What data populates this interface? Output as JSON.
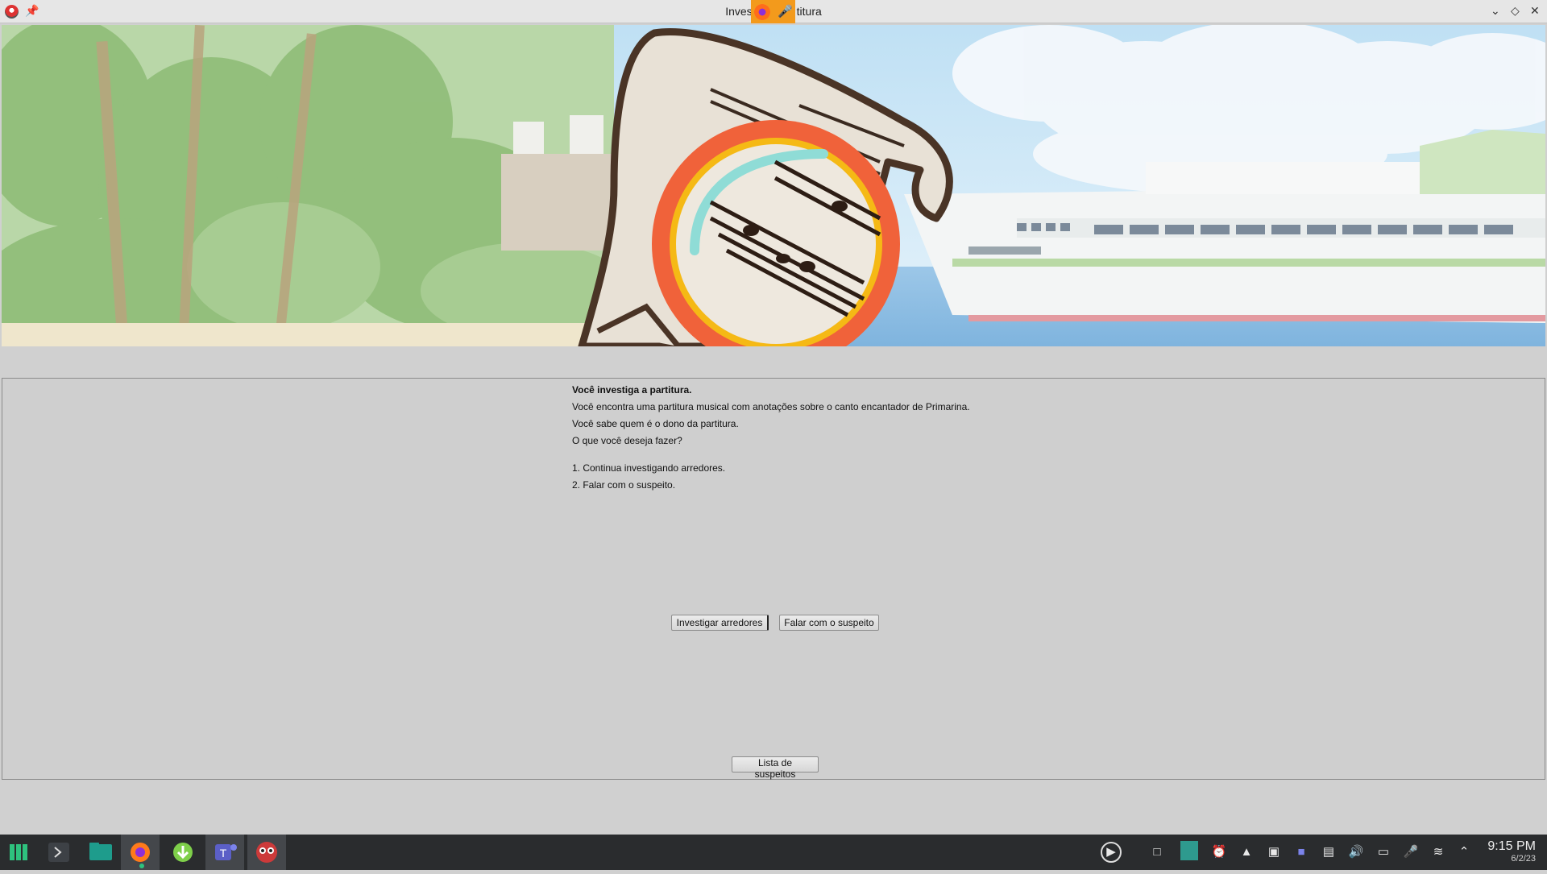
{
  "window": {
    "title": "Investiga a partitura",
    "title_visible_left": "Inves",
    "title_visible_right": "titura"
  },
  "story": {
    "heading": "Você investiga a partitura.",
    "lines": [
      "Você encontra uma partitura musical com anotações sobre o canto encantador de Primarina.",
      "Você sabe quem é o dono da partitura.",
      "O que você deseja fazer?"
    ],
    "options": [
      "1. Continua investigando arredores.",
      "2. Falar com o suspeito."
    ]
  },
  "buttons": {
    "investigate": "Investigar arredores",
    "talk": "Falar com o suspeito",
    "suspects": "Lista de suspeitos"
  },
  "taskbar": {
    "time": "9:15 PM",
    "date": "6/2/23"
  },
  "icons": {
    "app": "pokeball-app-icon",
    "pin": "pin-icon",
    "firefox": "firefox-icon",
    "mic": "microphone-icon"
  },
  "colors": {
    "accent": "#f39a1c",
    "taskbar": "#2a2c2e",
    "panel": "#cfcfcf",
    "magnifier_ring": "#f0623a",
    "magnifier_inner_ring": "#f5b915"
  }
}
